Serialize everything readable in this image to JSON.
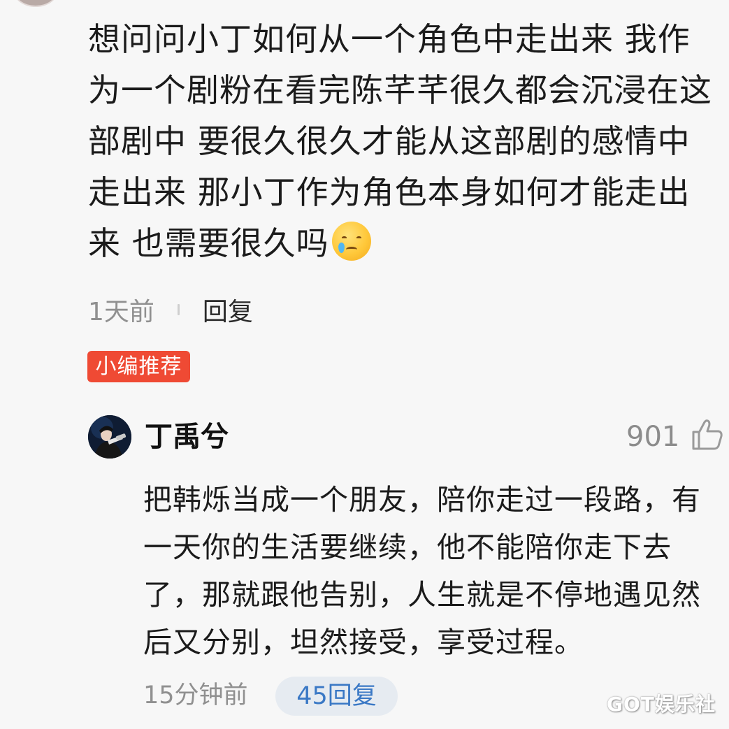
{
  "comment": {
    "text": "想问问小丁如何从一个角色中走出来 我作为一个剧粉在看完陈芊芊很久都会沉浸在这部剧中 要很久很久才能从这部剧的感情中走出来 那小丁作为角色本身如何才能走出来 也需要很久吗",
    "emoji": "crying-face",
    "time": "1天前",
    "reply_label": "回复"
  },
  "badge": {
    "label": "小编推荐",
    "color": "#ef4a34"
  },
  "reply": {
    "author": "丁禹兮",
    "likes": "901",
    "text": "把韩烁当成一个朋友，陪你走过一段路，有一天你的生活要继续，他不能陪你走下去了，那就跟他告别，人生就是不停地遇见然后又分别，坦然接受，享受过程。",
    "time": "15分钟前",
    "reply_count_label": "45回复",
    "accent_color": "#3a78c5"
  },
  "watermark": "GOT娱乐社"
}
